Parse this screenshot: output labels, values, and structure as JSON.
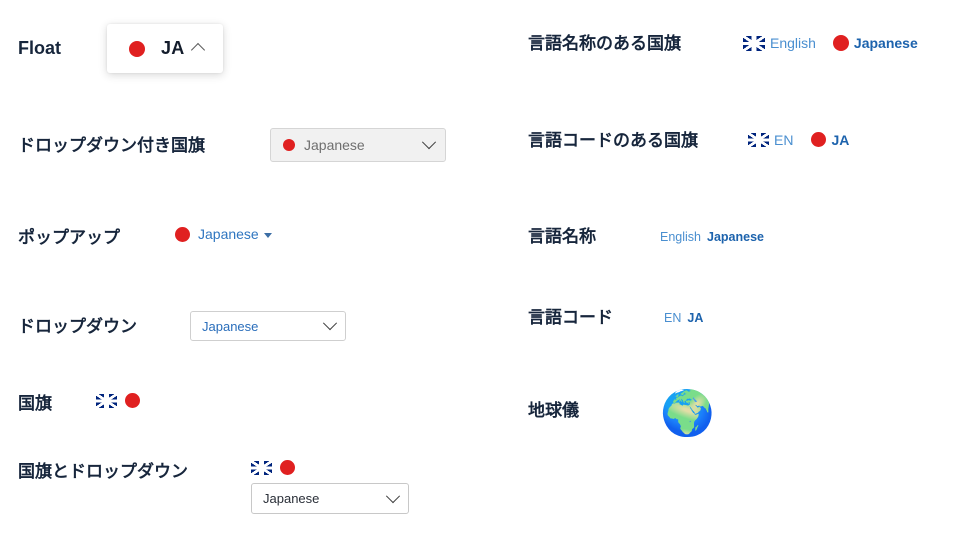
{
  "page": {
    "background": "#ffffff",
    "label_color": "#17263c",
    "accent_blue": "#1d63ad",
    "muted_blue": "#4a8fd0",
    "jp_red": "#e02020"
  },
  "rows": {
    "float": {
      "label": "Float",
      "button": {
        "flag": "jp-flag-icon",
        "code": "JA",
        "chevron": "chevron-up-icon"
      }
    },
    "flag_with_dropdown": {
      "label": "ドロップダウン付き国旗",
      "select": {
        "flag": "jp-flag-icon",
        "value": "Japanese",
        "chevron": "chevron-down-icon"
      }
    },
    "popup": {
      "label": "ポップアップ",
      "trigger": {
        "flag": "jp-flag-icon",
        "value": "Japanese",
        "caret": "caret-down-icon"
      }
    },
    "dropdown": {
      "label": "ドロップダウン",
      "select": {
        "value": "Japanese",
        "chevron": "chevron-down-icon"
      }
    },
    "flags": {
      "label": "国旗",
      "items": [
        {
          "flag": "gb-flag-icon",
          "lang": "English"
        },
        {
          "flag": "jp-flag-icon",
          "lang": "Japanese"
        }
      ]
    },
    "flags_and_dropdown": {
      "label": "国旗とドロップダウン",
      "items": [
        {
          "flag": "gb-flag-icon",
          "lang": "English"
        },
        {
          "flag": "jp-flag-icon",
          "lang": "Japanese"
        }
      ],
      "select": {
        "value": "Japanese",
        "chevron": "chevron-down-icon"
      }
    },
    "flags_with_names": {
      "label": "言語名称のある国旗",
      "items": [
        {
          "flag": "gb-flag-icon",
          "text": "English",
          "active": false
        },
        {
          "flag": "jp-flag-icon",
          "text": "Japanese",
          "active": true
        }
      ]
    },
    "flags_with_codes": {
      "label": "言語コードのある国旗",
      "items": [
        {
          "flag": "gb-flag-icon",
          "text": "EN",
          "active": false
        },
        {
          "flag": "jp-flag-icon",
          "text": "JA",
          "active": true
        }
      ]
    },
    "language_names": {
      "label": "言語名称",
      "items": [
        {
          "text": "English",
          "active": false
        },
        {
          "text": "Japanese",
          "active": true
        }
      ]
    },
    "language_codes": {
      "label": "言語コード",
      "items": [
        {
          "text": "EN",
          "active": false
        },
        {
          "text": "JA",
          "active": true
        }
      ]
    },
    "globe": {
      "label": "地球儀",
      "icon": "globe-icon",
      "glyph": "🌍"
    }
  }
}
